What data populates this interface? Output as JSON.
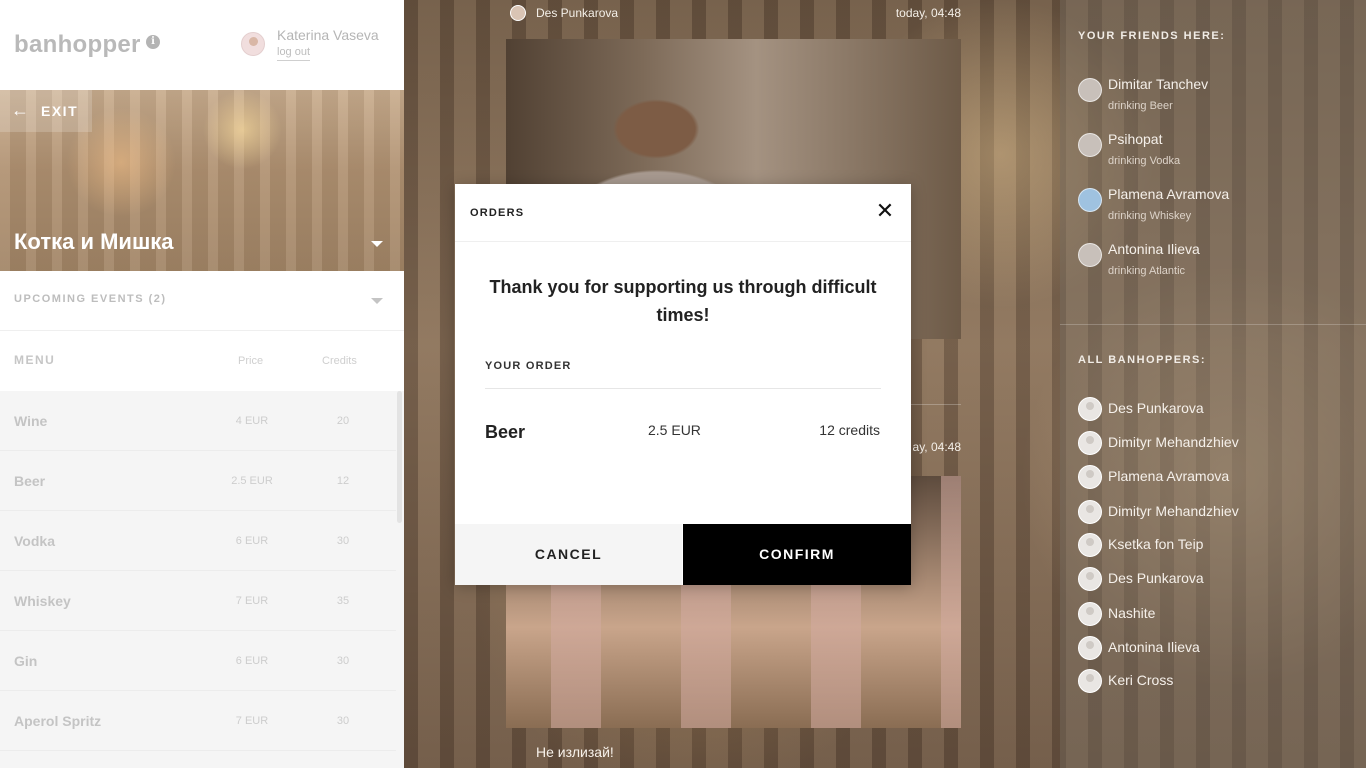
{
  "app": {
    "logo": "banhopper",
    "user_name": "Katerina Vaseva",
    "logout_label": "log out"
  },
  "venue": {
    "exit_label": "EXIT",
    "name": "Котка и Мишка"
  },
  "events": {
    "label": "UPCOMING EVENTS (2)"
  },
  "menu": {
    "title": "MENU",
    "price_header": "Price",
    "credits_header": "Credits",
    "items": [
      {
        "name": "Wine",
        "price": "4 EUR",
        "credits": "20"
      },
      {
        "name": "Beer",
        "price": "2.5 EUR",
        "credits": "12"
      },
      {
        "name": "Vodka",
        "price": "6 EUR",
        "credits": "30"
      },
      {
        "name": "Whiskey",
        "price": "7 EUR",
        "credits": "35"
      },
      {
        "name": "Gin",
        "price": "6 EUR",
        "credits": "30"
      },
      {
        "name": "Aperol Spritz",
        "price": "7 EUR",
        "credits": "30"
      }
    ]
  },
  "feed": {
    "posts": [
      {
        "author": "Des Punkarova",
        "time": "today, 04:48"
      },
      {
        "author": "",
        "time": "ay, 04:48"
      }
    ],
    "caption": "Не излизай!"
  },
  "friends": {
    "title": "YOUR FRIENDS HERE:",
    "items": [
      {
        "name": "Dimitar Tanchev",
        "drinking": "drinking Beer"
      },
      {
        "name": "Psihopat",
        "drinking": "drinking Vodka"
      },
      {
        "name": "Plamena Avramova",
        "drinking": "drinking Whiskey"
      },
      {
        "name": "Antonina Ilieva",
        "drinking": "drinking Atlantic"
      }
    ]
  },
  "banhoppers": {
    "title": "ALL BANHOPPERS:",
    "items": [
      "Des Punkarova",
      "Dimityr Mehandzhiev",
      "Plamena Avramova",
      "Dimityr Mehandzhiev",
      "Ksetka fon Teip",
      "Des Punkarova",
      "Nashite",
      "Antonina Ilieva",
      "Keri Cross"
    ]
  },
  "modal": {
    "title": "ORDERS",
    "message": "Thank you for supporting us through difficult times!",
    "order_label": "YOUR ORDER",
    "item": "Beer",
    "price": "2.5 EUR",
    "credits": "12 credits",
    "cancel_label": "CANCEL",
    "confirm_label": "CONFIRM"
  },
  "icons": {
    "info": "info-icon",
    "exit": "arrow-left-icon",
    "close": "close-icon",
    "dropdown": "caret-down-icon"
  }
}
